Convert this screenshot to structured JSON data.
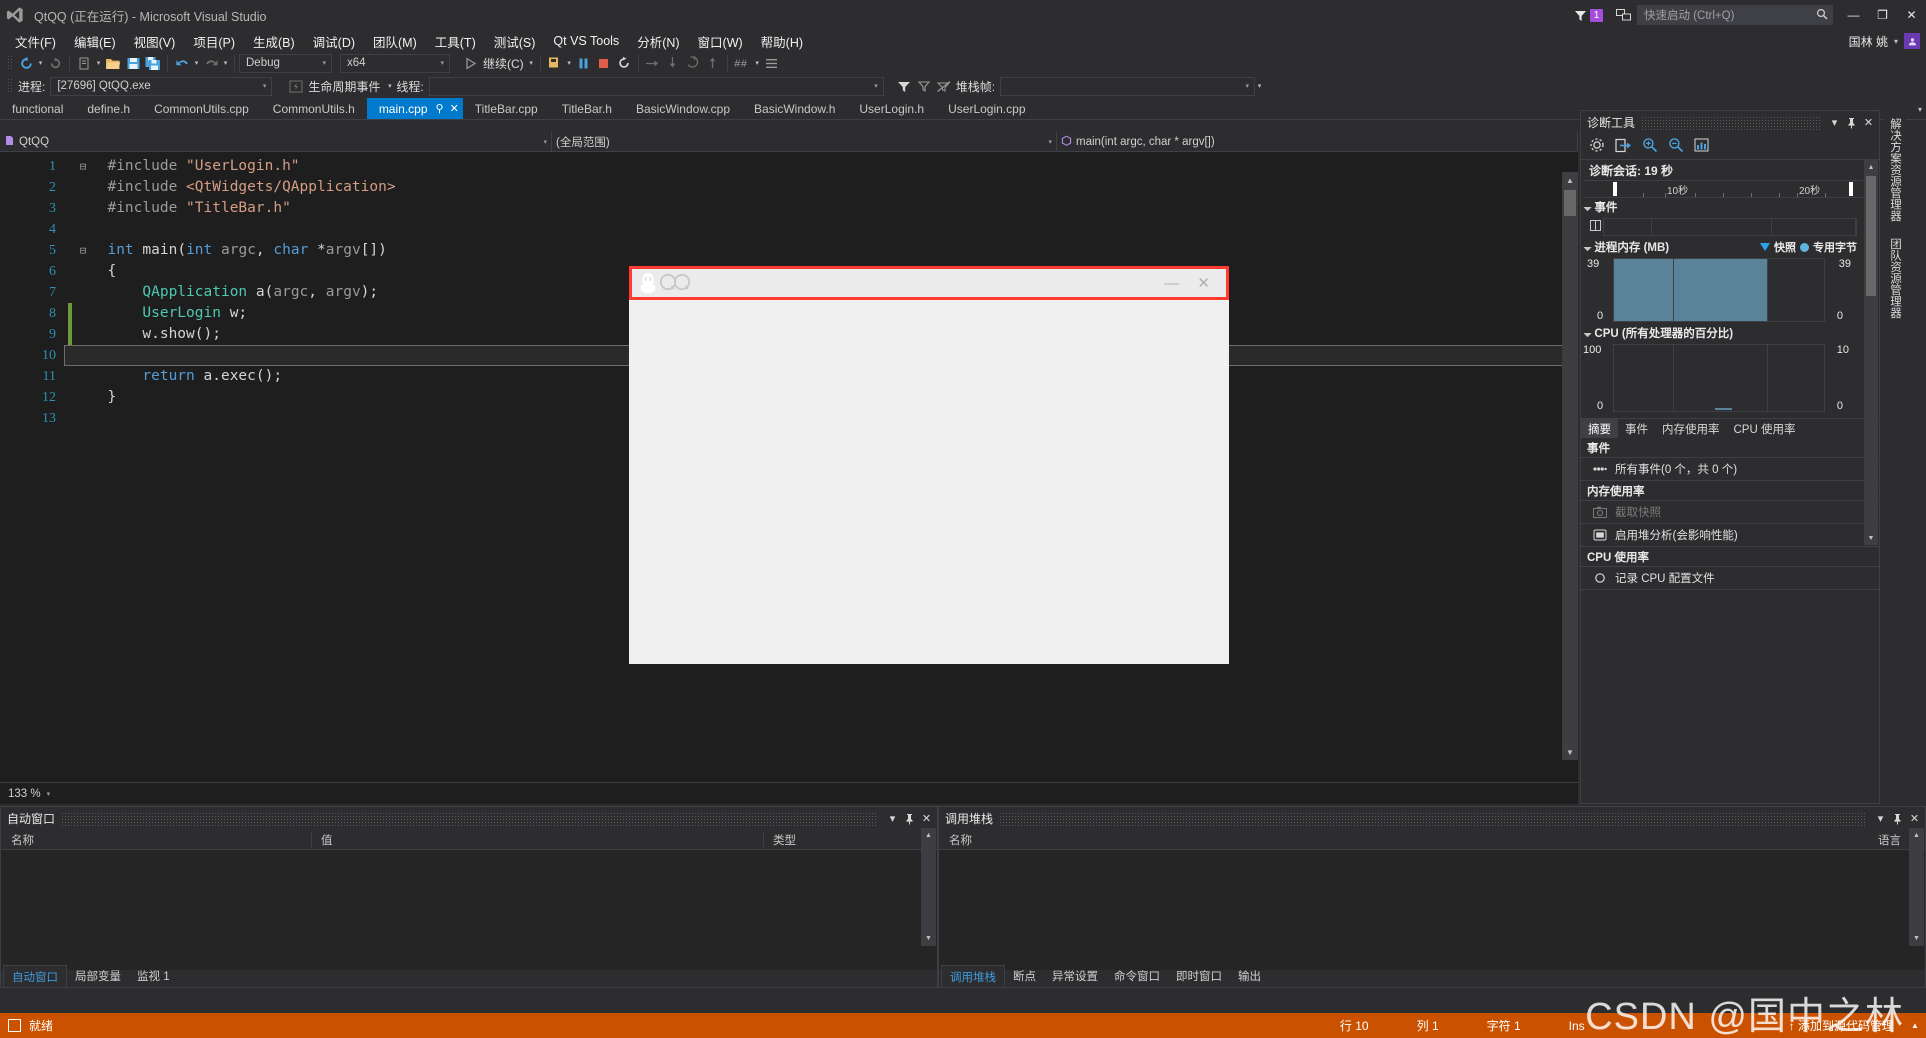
{
  "window": {
    "title": "QtQQ (正在运行) - Microsoft Visual Studio",
    "logo_icon": "visual-studio-logo",
    "minimize": "—",
    "maximize": "❐",
    "close": "✕"
  },
  "titlebar_right": {
    "notification_icon": "funnel-icon",
    "notification_count": "1",
    "feedback_icon": "feedback-icon",
    "quick_launch_placeholder": "快速启动 (Ctrl+Q)",
    "search_icon": "search-icon"
  },
  "account": {
    "name": "国林 姚",
    "caret": "▾",
    "avatar_icon": "user-avatar"
  },
  "menubar": {
    "items": [
      {
        "label": "文件(F)"
      },
      {
        "label": "编辑(E)"
      },
      {
        "label": "视图(V)"
      },
      {
        "label": "项目(P)"
      },
      {
        "label": "生成(B)"
      },
      {
        "label": "调试(D)"
      },
      {
        "label": "团队(M)"
      },
      {
        "label": "工具(T)"
      },
      {
        "label": "测试(S)"
      },
      {
        "label": "Qt VS Tools"
      },
      {
        "label": "分析(N)"
      },
      {
        "label": "窗口(W)"
      },
      {
        "label": "帮助(H)"
      }
    ]
  },
  "toolbar": {
    "back_icon": "navigate-back-icon",
    "forward_icon": "navigate-forward-icon",
    "new_project_icon": "new-project-icon",
    "open_file_icon": "open-file-icon",
    "save_icon": "save-icon",
    "save_all_icon": "save-all-icon",
    "undo_icon": "undo-icon",
    "redo_icon": "redo-icon",
    "config_value": "Debug",
    "platform_value": "x64",
    "continue_icon": "play-icon",
    "continue_label": "继续(C)",
    "attach_icon": "attach-process-icon",
    "pause_icon": "pause-icon",
    "stop_icon": "stop-icon",
    "restart_icon": "restart-icon",
    "step_over_icon": "step-over-icon",
    "step_into_icon": "step-into-icon",
    "step_out_icon": "step-out-icon",
    "up_icon": "step-up-icon",
    "hexadecimal_icon": "hex-display-icon",
    "threads_icon": "threads-icon"
  },
  "debug_toolbar": {
    "process_label": "进程:",
    "process_value": "[27696] QtQQ.exe",
    "lifecycle_icon": "lifecycle-events-icon",
    "lifecycle_label": "生命周期事件",
    "thread_label": "线程:",
    "thread_value": "",
    "filter_icon": "filter-icon",
    "filter_clear_icon": "filter-clear-icon",
    "no_filter_icon": "no-filter-icon",
    "stackframe_label": "堆栈帧:",
    "stackframe_value": ""
  },
  "tabs": {
    "items": [
      {
        "label": "functional",
        "active": false
      },
      {
        "label": "define.h",
        "active": false
      },
      {
        "label": "CommonUtils.cpp",
        "active": false
      },
      {
        "label": "CommonUtils.h",
        "active": false
      },
      {
        "label": "main.cpp",
        "active": true,
        "pin": "⚲",
        "close": "✕"
      },
      {
        "label": "TitleBar.cpp",
        "active": false
      },
      {
        "label": "TitleBar.h",
        "active": false
      },
      {
        "label": "BasicWindow.cpp",
        "active": false
      },
      {
        "label": "BasicWindow.h",
        "active": false
      },
      {
        "label": "UserLogin.h",
        "active": false
      },
      {
        "label": "UserLogin.cpp",
        "active": false
      }
    ],
    "overflow_icon": "chevron-down-icon"
  },
  "navbar": {
    "project_icon": "project-icon",
    "project": "QtQQ",
    "scope": "(全局范围)",
    "member_icon": "method-icon",
    "member": "main(int argc, char * argv[])",
    "dropdown_icon": "chevron-down-icon"
  },
  "editor": {
    "zoom": "133 %",
    "zoom_dropdown": "▾",
    "lines": [
      {
        "n": "1",
        "fold": "⊟",
        "indent": 0,
        "tokens": [
          {
            "t": "#include ",
            "c": "pre"
          },
          {
            "t": "\"UserLogin.h\"",
            "c": "str"
          }
        ]
      },
      {
        "n": "2",
        "fold": "",
        "indent": 0,
        "tokens": [
          {
            "t": "#include ",
            "c": "pre"
          },
          {
            "t": "<QtWidgets/QApplication>",
            "c": "str"
          }
        ]
      },
      {
        "n": "3",
        "fold": "",
        "indent": 0,
        "tokens": [
          {
            "t": "#include ",
            "c": "pre"
          },
          {
            "t": "\"TitleBar.h\"",
            "c": "str"
          }
        ]
      },
      {
        "n": "4",
        "fold": "",
        "indent": 0,
        "tokens": []
      },
      {
        "n": "5",
        "fold": "⊟",
        "indent": 0,
        "tokens": [
          {
            "t": "int",
            "c": "kw"
          },
          {
            "t": " ",
            "c": "pl"
          },
          {
            "t": "main",
            "c": "pl"
          },
          {
            "t": "(",
            "c": "pl"
          },
          {
            "t": "int",
            "c": "kw"
          },
          {
            "t": " ",
            "c": "pl"
          },
          {
            "t": "argc",
            "c": "var"
          },
          {
            "t": ", ",
            "c": "pl"
          },
          {
            "t": "char",
            "c": "kw"
          },
          {
            "t": " *",
            "c": "pl"
          },
          {
            "t": "argv",
            "c": "var"
          },
          {
            "t": "[])",
            "c": "pl"
          }
        ]
      },
      {
        "n": "6",
        "fold": "",
        "indent": 0,
        "tokens": [
          {
            "t": "{",
            "c": "pl"
          }
        ]
      },
      {
        "n": "7",
        "fold": "",
        "indent": 1,
        "tokens": [
          {
            "t": "QApplication",
            "c": "type"
          },
          {
            "t": " a(",
            "c": "pl"
          },
          {
            "t": "argc",
            "c": "var"
          },
          {
            "t": ", ",
            "c": "pl"
          },
          {
            "t": "argv",
            "c": "var"
          },
          {
            "t": ");",
            "c": "pl"
          }
        ]
      },
      {
        "n": "8",
        "fold": "",
        "indent": 1,
        "changed": true,
        "tokens": [
          {
            "t": "UserLogin",
            "c": "type"
          },
          {
            "t": " w;",
            "c": "pl"
          }
        ]
      },
      {
        "n": "9",
        "fold": "",
        "indent": 1,
        "changed": true,
        "tokens": [
          {
            "t": "w.show();",
            "c": "pl"
          }
        ]
      },
      {
        "n": "10",
        "fold": "",
        "indent": 1,
        "changed": true,
        "current": true,
        "tokens": []
      },
      {
        "n": "11",
        "fold": "",
        "indent": 1,
        "tokens": [
          {
            "t": "return",
            "c": "kw"
          },
          {
            "t": " a.exec();",
            "c": "pl"
          }
        ]
      },
      {
        "n": "12",
        "fold": "",
        "indent": 0,
        "tokens": [
          {
            "t": "}",
            "c": "pl"
          }
        ]
      },
      {
        "n": "13",
        "fold": "",
        "indent": 0,
        "tokens": []
      }
    ]
  },
  "qq_window": {
    "app_icon": "qq-penguin-icon",
    "app_name_icon": "qq-wordmark-icon",
    "minimize": "—",
    "close": "✕",
    "highlight_color": "#ff3b30"
  },
  "diagnostics": {
    "title": "诊断工具",
    "dropdown_icon": "chevron-down-icon",
    "pin_icon": "pin-icon",
    "close_icon": "close-icon",
    "toolbar": {
      "settings_icon": "gear-icon",
      "export_icon": "export-icon",
      "zoom_in_icon": "zoom-in-icon",
      "zoom_out_icon": "zoom-out-icon",
      "report_icon": "report-icon"
    },
    "session_label": "诊断会话: 19 秒",
    "ruler": {
      "ticks": [
        "10秒",
        "20秒"
      ]
    },
    "events_section": "事件",
    "memory_section": "进程内存 (MB)",
    "memory_legend": {
      "snapshot": "快照",
      "private_bytes": "专用字节"
    },
    "memory_axis": {
      "max_left": "39",
      "min_left": "0",
      "max_right": "39",
      "min_right": "0"
    },
    "cpu_section": "CPU (所有处理器的百分比)",
    "cpu_axis": {
      "max_left": "100",
      "min_left": "0",
      "max_right": "10",
      "min_right": "0"
    },
    "tabs": [
      {
        "label": "摘要",
        "active": true
      },
      {
        "label": "事件",
        "active": false
      },
      {
        "label": "内存使用率",
        "active": false
      },
      {
        "label": "CPU 使用率",
        "active": false
      }
    ],
    "summary": {
      "events_header": "事件",
      "events_item": {
        "icon": "events-icon",
        "label": "所有事件(0 个，共 0 个)"
      },
      "memory_header": "内存使用率",
      "memory_items": [
        {
          "icon": "camera-icon",
          "label": "截取快照",
          "disabled": true
        },
        {
          "icon": "heap-icon",
          "label": "启用堆分析(会影响性能)",
          "disabled": false
        }
      ],
      "cpu_header": "CPU 使用率",
      "cpu_item": {
        "icon": "record-icon",
        "label": "记录 CPU 配置文件"
      }
    }
  },
  "vertical_dock": {
    "tabs": [
      "解决方案资源管理器",
      "团队资源管理器"
    ]
  },
  "autos_panel": {
    "title": "自动窗口",
    "dropdown_icon": "chevron-down-icon",
    "pin_icon": "pin-icon",
    "close_icon": "close-icon",
    "columns": [
      "名称",
      "值",
      "类型"
    ],
    "tabs": [
      {
        "label": "自动窗口",
        "active": true
      },
      {
        "label": "局部变量",
        "active": false
      },
      {
        "label": "监视 1",
        "active": false
      }
    ]
  },
  "callstack_panel": {
    "title": "调用堆栈",
    "dropdown_icon": "chevron-down-icon",
    "pin_icon": "pin-icon",
    "close_icon": "close-icon",
    "columns": [
      "名称",
      "语言"
    ],
    "tabs": [
      {
        "label": "调用堆栈",
        "active": true
      },
      {
        "label": "断点",
        "active": false
      },
      {
        "label": "异常设置",
        "active": false
      },
      {
        "label": "命令窗口",
        "active": false
      },
      {
        "label": "即时窗口",
        "active": false
      },
      {
        "label": "输出",
        "active": false
      }
    ]
  },
  "statusbar": {
    "icon": "status-icon",
    "text": "就绪",
    "line": "行 10",
    "column": "列 1",
    "character": "字符 1",
    "insert_mode": "Ins",
    "source_control": "↑ 添加到源代码管理",
    "up_icon": "chevron-up-icon",
    "background": "#ca5100"
  },
  "watermark": {
    "line1": "CSDN @国中之林"
  },
  "colors": {
    "accent": "#007acc",
    "chrome": "#2d2d30",
    "editor_bg": "#1e1e1e",
    "status_orange": "#ca5100"
  }
}
